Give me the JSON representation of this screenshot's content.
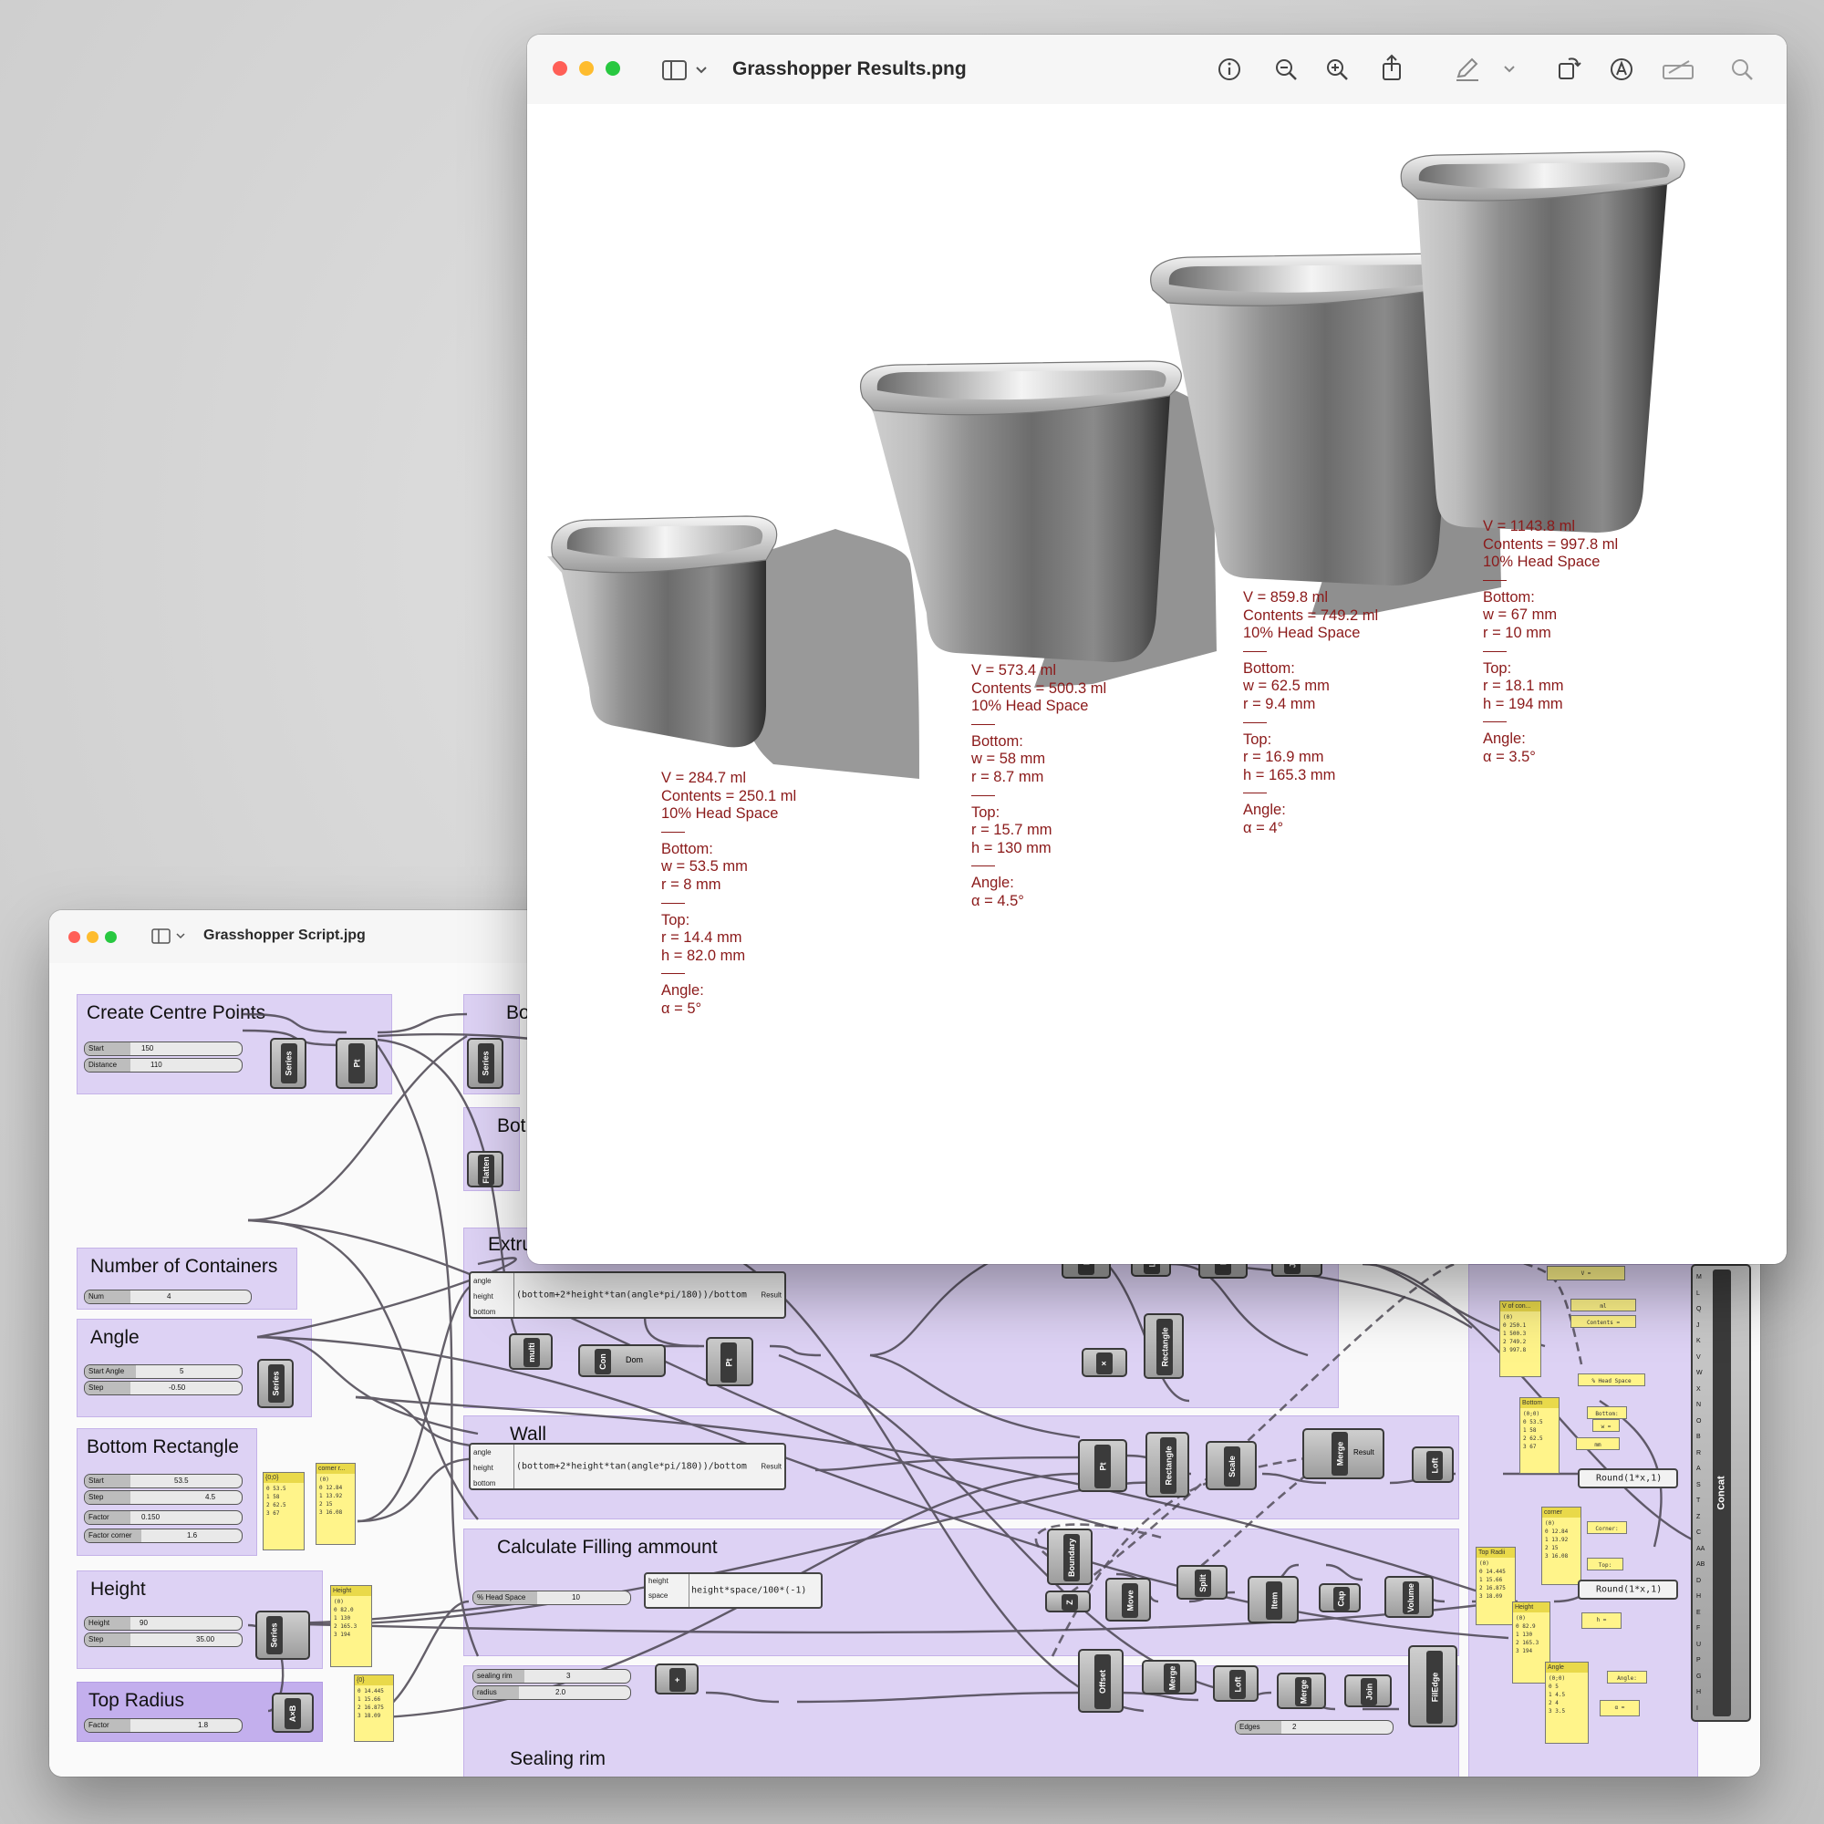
{
  "script_window": {
    "title": "Grasshopper Script.jpg",
    "groups": {
      "centre_points": "Create Centre Points",
      "bottom_top": "Bo",
      "bottom_flatten": "Bot",
      "number_of_containers": "Number of Containers",
      "angle": "Angle",
      "bottom_rectangle": "Bottom Rectangle",
      "height": "Height",
      "top_radius": "Top Radius",
      "extrude": "Extru",
      "wall": "Wall",
      "filling": "Calculate Filling ammount",
      "sealing_rim": "Sealing rim"
    },
    "sliders": {
      "start": {
        "label": "Start",
        "value": "150"
      },
      "distance": {
        "label": "Distance",
        "value": "110"
      },
      "num": {
        "label": "Num",
        "value": "4"
      },
      "start_angle": {
        "label": "Start Angle",
        "value": "5"
      },
      "angle_step": {
        "label": "Step",
        "value": "-0.50"
      },
      "rect_start": {
        "label": "Start",
        "value": "53.5"
      },
      "rect_step": {
        "label": "Step",
        "value": "4.5"
      },
      "factor": {
        "label": "Factor",
        "value": "0.150"
      },
      "factor_corner": {
        "label": "Factor corner",
        "value": "1.6"
      },
      "height": {
        "label": "Height",
        "value": "90"
      },
      "height_step": {
        "label": "Step",
        "value": "35.00"
      },
      "top_factor": {
        "label": "Factor",
        "value": "1.8"
      },
      "head_space": {
        "label": "% Head Space",
        "value": "10"
      },
      "sealing_rim": {
        "label": "sealing rim",
        "value": "3"
      },
      "radius": {
        "label": "radius",
        "value": "2.0"
      },
      "edges": {
        "label": "Edges",
        "value": "2"
      }
    },
    "components": {
      "series": "Series",
      "pt": "Pt",
      "flatten": "Flatten",
      "multi": "multi",
      "con": "Con",
      "dom": "Dom",
      "merge": "Merge",
      "loft": "Loft",
      "join": "Join",
      "rectangle": "Rectangle",
      "scale": "Scale",
      "boundary": "Boundary",
      "move": "Move",
      "split": "Split",
      "item": "Item",
      "cap": "Cap",
      "volume": "Volume",
      "offset": "Offset",
      "filledge": "FilEdge",
      "concat": "Concat",
      "axb": "A×B",
      "z": "Z"
    },
    "expressions": {
      "extrude": "(bottom+2*height*tan(angle*pi/180))/bottom",
      "wall": "(bottom+2*height*tan(angle*pi/180))/bottom",
      "filling": "height*space/100*(-1)",
      "round1": "Round(1*x,1)",
      "round2": "Round(1*x,1)",
      "inputs_angle": [
        "angle",
        "height",
        "bottom"
      ],
      "inputs_filling": [
        "height",
        "space"
      ],
      "result": "Result"
    },
    "panels": {
      "rect_values": {
        "header": "{0;0}",
        "lines": [
          "0 53.5",
          "1 58",
          "2 62.5",
          "3 67"
        ]
      },
      "corner": {
        "header": "corner r...",
        "lines": [
          "(0)",
          "0 12.84",
          "1 13.92",
          "2 15",
          "3 16.08"
        ]
      },
      "height": {
        "header": "Height",
        "lines": [
          "(0)",
          "0 82.0",
          "1 130",
          "2 165.3",
          "3 194"
        ]
      },
      "top_radius": {
        "header": "{0}",
        "lines": [
          "0 14.445",
          "1 15.66",
          "2 16.875",
          "3 18.09"
        ]
      },
      "v_of_con": {
        "header": "V of con...",
        "lines": [
          "(0)",
          "0 250.1",
          "1 500.3",
          "2 749.2",
          "3 997.8"
        ]
      },
      "bottom": {
        "header": "Bottom",
        "lines": [
          "(0;0)",
          "0 53.5",
          "1 58",
          "2 62.5",
          "3 67"
        ]
      },
      "corner2": {
        "header": "corner",
        "lines": [
          "(0)",
          "0 12.84",
          "1 13.92",
          "2 15",
          "3 16.08"
        ]
      },
      "top_radii": {
        "header": "Top Radii",
        "lines": [
          "(0)",
          "0 14.445",
          "1 15.66",
          "2 16.875",
          "3 18.09"
        ]
      },
      "height2": {
        "header": "Height",
        "lines": [
          "(0)",
          "0 82.9",
          "1 130",
          "2 165.3",
          "3 194"
        ]
      },
      "angle": {
        "header": "Angle",
        "lines": [
          "(0;0)",
          "0 5",
          "1 4.5",
          "2 4",
          "3 3.5"
        ]
      }
    },
    "concat_inputs": [
      "M",
      "L",
      "Q",
      "J",
      "K",
      "V",
      "W",
      "X",
      "N",
      "O",
      "B",
      "R",
      "A",
      "S",
      "T",
      "Z",
      "C",
      "AA",
      "AB",
      "D",
      "H",
      "E",
      "F",
      "U",
      "P",
      "G",
      "H",
      "I"
    ],
    "text_chips": {
      "v": "V =",
      "ml": "ml",
      "contents": "Contents =",
      "head_space": "% Head Space",
      "bottom_l": "Bottom:",
      "w": "w =",
      "mm": "mm",
      "corner_l": "Corner:",
      "r": "r =",
      "top_l": "Top:",
      "h": "h =",
      "angle_l": "Angle:",
      "alpha": "α ="
    }
  },
  "results_window": {
    "title": "Grasshopper Results.png",
    "containers": [
      {
        "v": "V = 284.7 ml",
        "contents": "Contents = 250.1 ml",
        "head": "10% Head Space",
        "bottom": "Bottom:",
        "w": "w = 53.5 mm",
        "r": "r = 8 mm",
        "top": "Top:",
        "tr": "r = 14.4 mm",
        "h": "h = 82.0 mm",
        "angle": "Angle:",
        "alpha": "α = 5°"
      },
      {
        "v": "V = 573.4 ml",
        "contents": "Contents = 500.3 ml",
        "head": "10% Head Space",
        "bottom": "Bottom:",
        "w": "w = 58 mm",
        "r": "r = 8.7 mm",
        "top": "Top:",
        "tr": "r = 15.7 mm",
        "h": "h = 130 mm",
        "angle": "Angle:",
        "alpha": "α = 4.5°"
      },
      {
        "v": "V = 859.8 ml",
        "contents": "Contents = 749.2 ml",
        "head": "10% Head Space",
        "bottom": "Bottom:",
        "w": "w = 62.5 mm",
        "r": "r = 9.4 mm",
        "top": "Top:",
        "tr": "r = 16.9 mm",
        "h": "h = 165.3 mm",
        "angle": "Angle:",
        "alpha": "α = 4°"
      },
      {
        "v": "V = 1143.8 ml",
        "contents": "Contents = 997.8 ml",
        "head": "10% Head Space",
        "bottom": "Bottom:",
        "w": "w = 67 mm",
        "r": "r = 10 mm",
        "top": "Top:",
        "tr": "r = 18.1 mm",
        "h": "h = 194 mm",
        "angle": "Angle:",
        "alpha": "α = 3.5°"
      }
    ]
  },
  "colors": {
    "close": "#ff5f57",
    "minimize": "#febc2e",
    "maximize": "#28c840",
    "annotation": "#8b1a1a",
    "group": "#c4b0ee",
    "panel": "#fff48a"
  }
}
